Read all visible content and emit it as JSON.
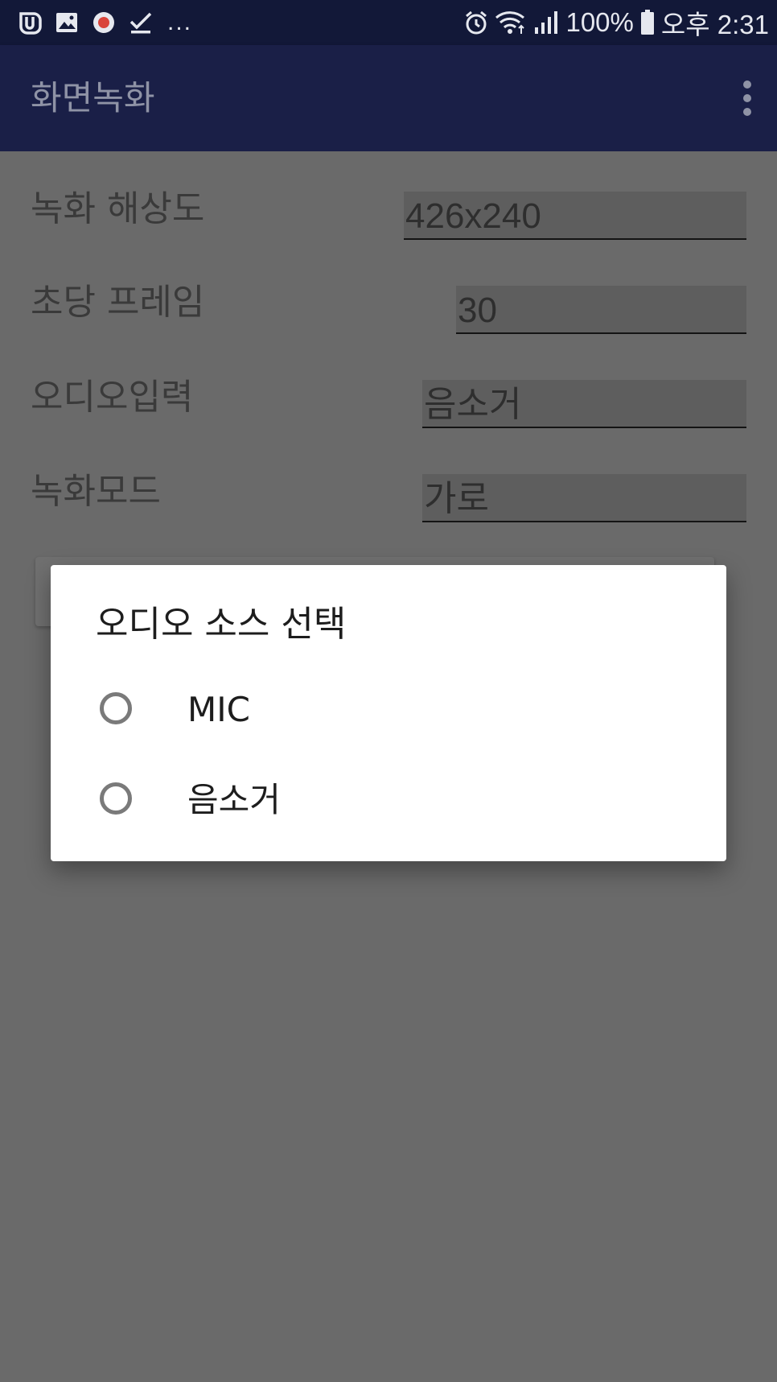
{
  "status_bar": {
    "left_icons": [
      "app-u-icon",
      "image-icon",
      "record-icon",
      "check-icon"
    ],
    "more_indicator": "...",
    "battery_percent": "100%",
    "time": "오후 2:31"
  },
  "app_bar": {
    "title": "화면녹화"
  },
  "settings": [
    {
      "label": "녹화 해상도",
      "value": "426x240"
    },
    {
      "label": "초당 프레임",
      "value": "30"
    },
    {
      "label": "오디오입력",
      "value": "음소거"
    },
    {
      "label": "녹화모드",
      "value": "가로"
    }
  ],
  "dialog": {
    "title": "오디오 소스 선택",
    "options": [
      {
        "label": "MIC",
        "selected": false
      },
      {
        "label": "음소거",
        "selected": false
      }
    ]
  },
  "colors": {
    "status_bar_bg": "#121838",
    "app_bar_bg": "#1a1f47",
    "scrim_bg": "#6a6a6a",
    "dialog_bg": "#ffffff"
  }
}
